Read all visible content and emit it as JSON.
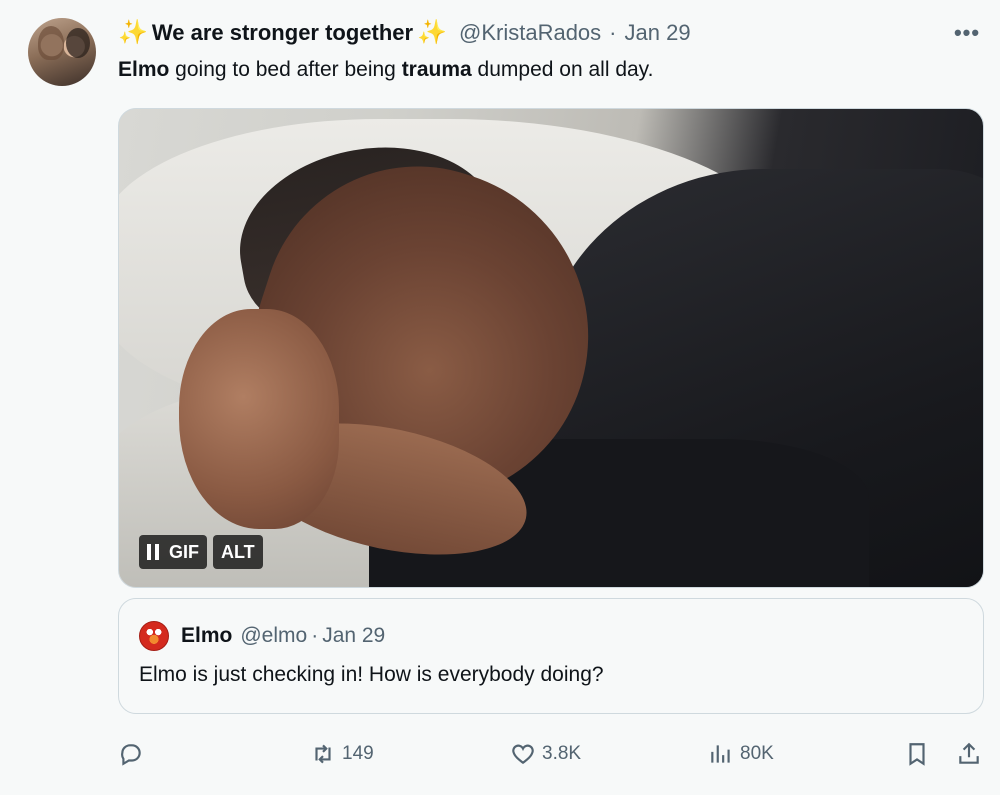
{
  "tweet": {
    "sparkle_left": "✨",
    "display_name": "We are stronger together",
    "sparkle_right": "✨",
    "handle": "@KristaRados",
    "separator": "·",
    "date": "Jan 29",
    "more_label": "•••",
    "text": {
      "part1": "Elmo",
      "part2": " going to bed after being ",
      "part3": "trauma",
      "part4": " dumped on all day."
    }
  },
  "media": {
    "badges": {
      "gif": "GIF",
      "alt": "ALT"
    }
  },
  "quote": {
    "display_name": "Elmo",
    "handle": "@elmo",
    "separator": "·",
    "date": "Jan 29",
    "text": "Elmo is just checking in! How is everybody doing?"
  },
  "actions": {
    "retweets": "149",
    "likes": "3.8K",
    "views": "80K"
  },
  "colors": {
    "text_primary": "#0f1419",
    "text_secondary": "#536471",
    "border": "#cfd9de",
    "background": "#f7f9f9"
  }
}
